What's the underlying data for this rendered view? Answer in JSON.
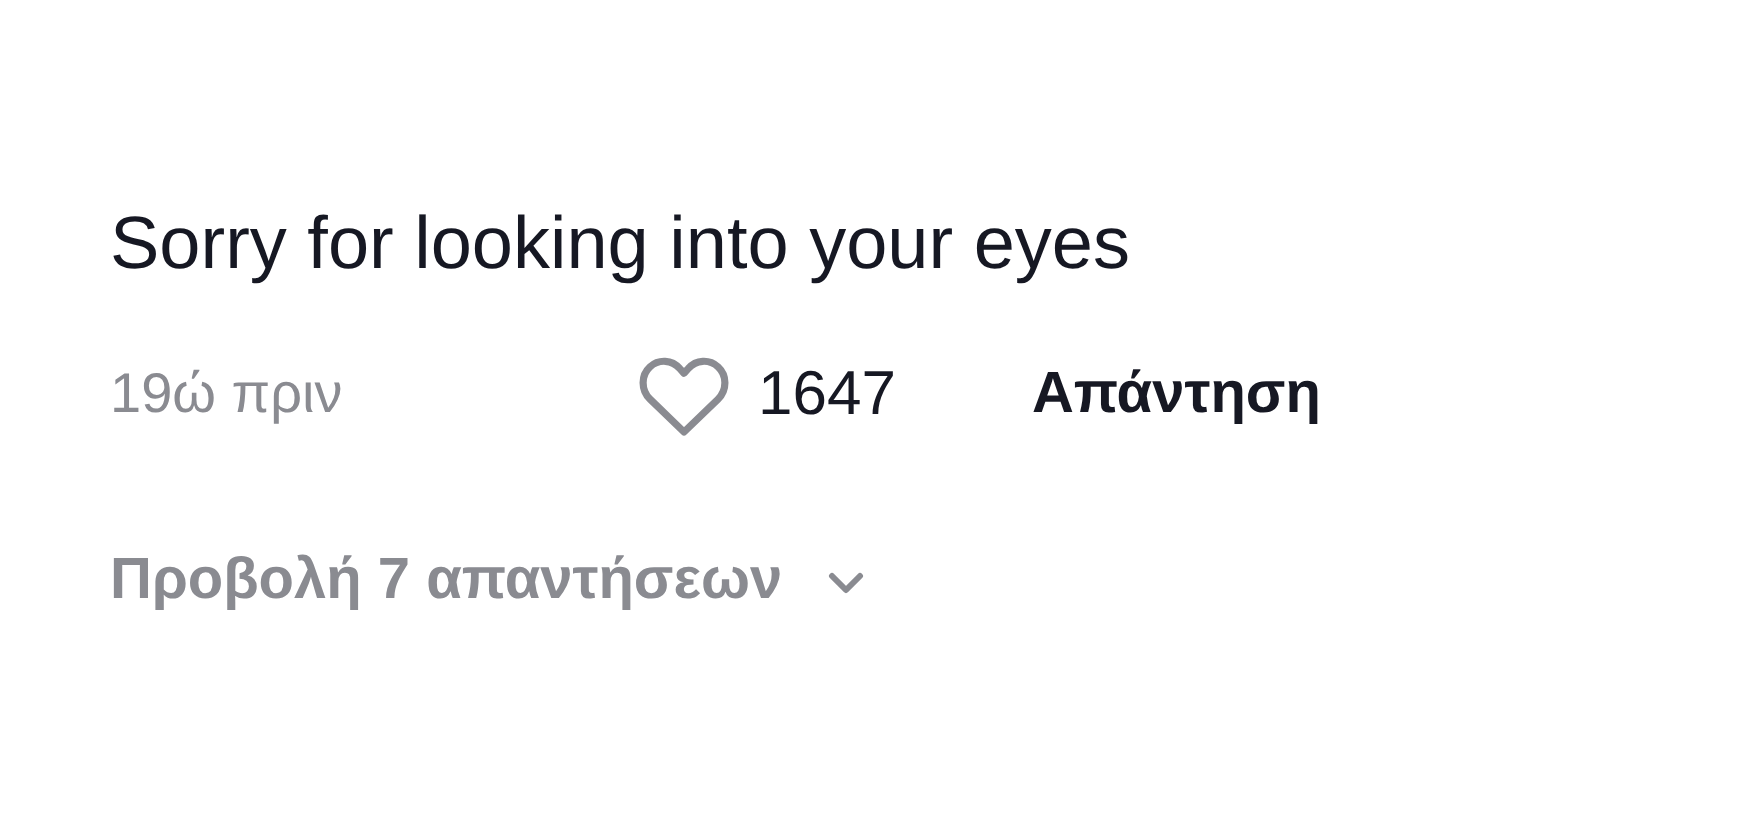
{
  "comment": {
    "text": "Sorry for looking into your eyes",
    "time": "19ώ πριν",
    "likes": "1647",
    "liked": false,
    "reply_label": "Απάντηση",
    "view_replies": "Προβολή 7 απαντήσεων",
    "replies_expanded": false
  }
}
